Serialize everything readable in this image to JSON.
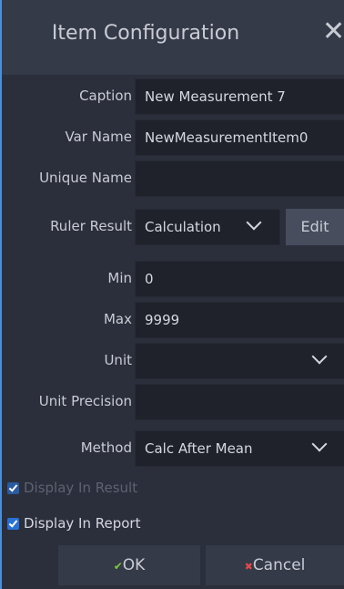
{
  "dialog": {
    "title": "Item Configuration"
  },
  "fields": {
    "caption": {
      "label": "Caption",
      "value": "New Measurement 7"
    },
    "var_name": {
      "label": "Var Name",
      "value": "NewMeasurementItem0"
    },
    "unique_name": {
      "label": "Unique Name",
      "value": ""
    },
    "ruler_result": {
      "label": "Ruler Result",
      "value": "Calculation",
      "edit_label": "Edit"
    },
    "min": {
      "label": "Min",
      "value": "0"
    },
    "max": {
      "label": "Max",
      "value": "9999"
    },
    "unit": {
      "label": "Unit",
      "value": ""
    },
    "unit_precision": {
      "label": "Unit Precision",
      "value": ""
    },
    "method": {
      "label": "Method",
      "value": "Calc After Mean"
    }
  },
  "checks": {
    "display_in_result": {
      "label": "Display In Result",
      "checked": true,
      "enabled": false
    },
    "display_in_report": {
      "label": "Display In Report",
      "checked": true,
      "enabled": true
    }
  },
  "buttons": {
    "ok": "OK",
    "cancel": "Cancel"
  },
  "colors": {
    "accent": "#2a71d6",
    "ok_icon": "#7ec83e",
    "cancel_icon": "#e04a4a"
  }
}
